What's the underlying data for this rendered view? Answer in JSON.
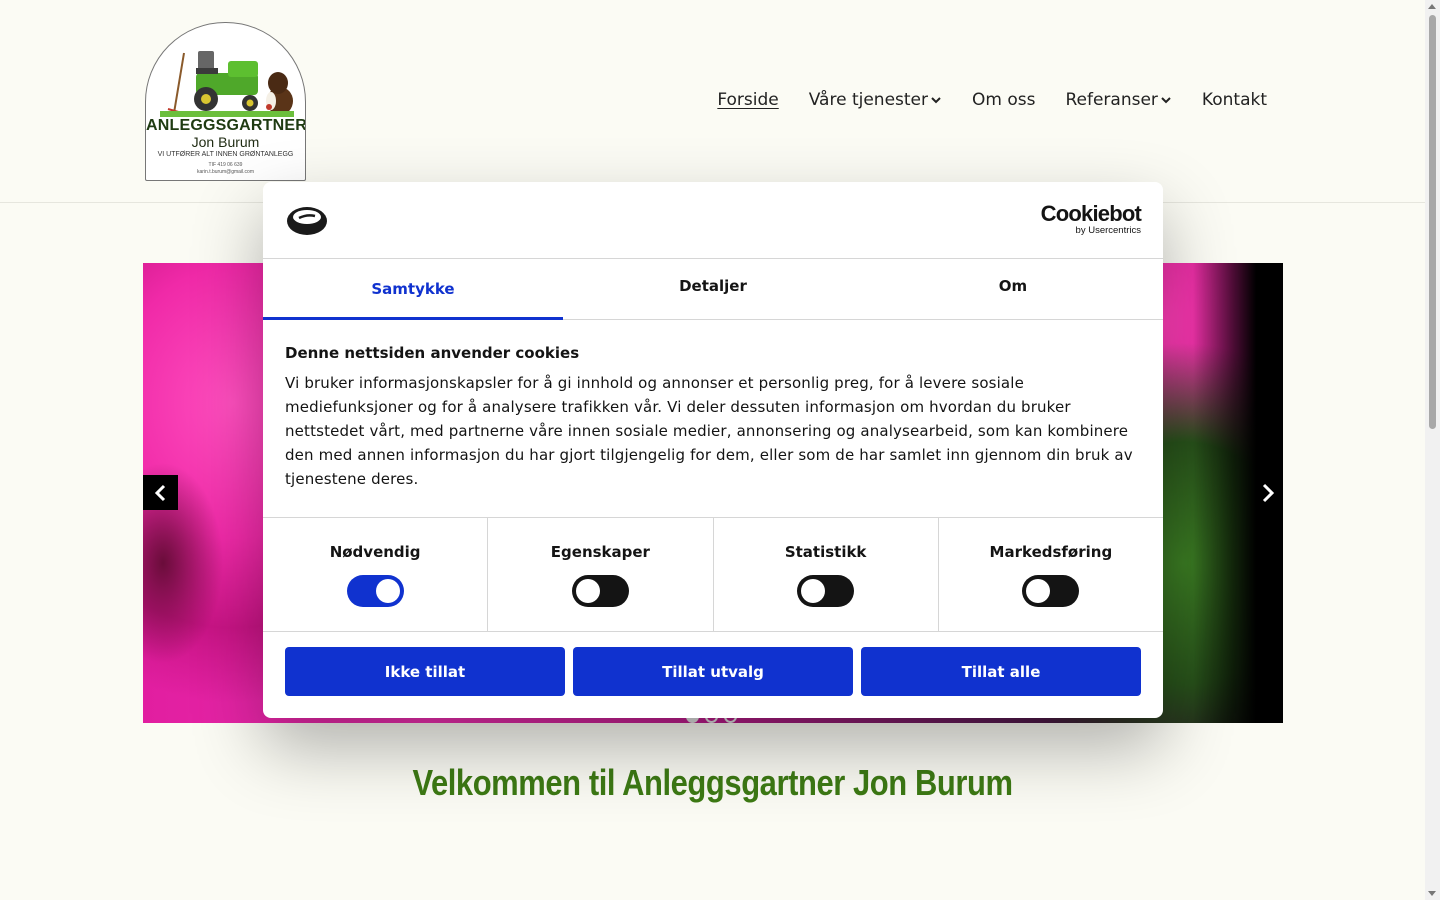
{
  "logo": {
    "title": "ANLEGGSGARTNER",
    "name": "Jon Burum",
    "tagline": "VI UTFØRER ALT INNEN GRØNTANLEGG",
    "phone": "TIF 419 06 639",
    "email": "karin.t.burum@gmail.com"
  },
  "nav": {
    "items": [
      {
        "label": "Forside"
      },
      {
        "label": "Våre tjenester"
      },
      {
        "label": "Om oss"
      },
      {
        "label": "Referanser"
      },
      {
        "label": "Kontakt"
      }
    ]
  },
  "welcome": "Velkommen til Anleggsgartner Jon Burum",
  "cookie": {
    "brand": "Cookiebot",
    "brand_by": "by Usercentrics",
    "tabs": [
      {
        "label": "Samtykke"
      },
      {
        "label": "Detaljer"
      },
      {
        "label": "Om"
      }
    ],
    "title": "Denne nettsiden anvender cookies",
    "text": "Vi bruker informasjonskapsler for å gi innhold og annonser et personlig preg, for å levere sosiale mediefunksjoner og for å analysere trafikken vår. Vi deler dessuten informasjon om hvordan du bruker nettstedet vårt, med partnerne våre innen sosiale medier, annonsering og analysearbeid, som kan kombinere den med annen informasjon du har gjort tilgjengelig for dem, eller som de har samlet inn gjennom din bruk av tjenestene deres.",
    "toggles": [
      {
        "label": "Nødvendig",
        "on": true
      },
      {
        "label": "Egenskaper",
        "on": false
      },
      {
        "label": "Statistikk",
        "on": false
      },
      {
        "label": "Markedsføring",
        "on": false
      }
    ],
    "buttons": {
      "deny": "Ikke tillat",
      "selection": "Tillat utvalg",
      "all": "Tillat alle"
    },
    "accent": "#1032cf"
  },
  "slider": {
    "slide_count": 3,
    "active_slide": 1
  },
  "colors": {
    "welcome_green": "#3d7a14",
    "background": "#fbfbf4"
  }
}
